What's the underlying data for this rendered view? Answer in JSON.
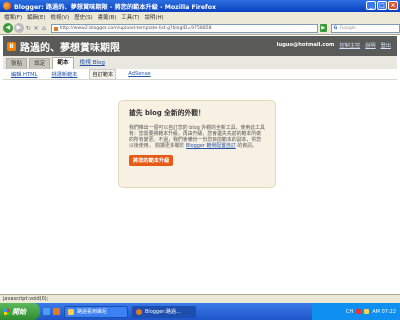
{
  "window": {
    "title": "Blogger: 路過的、夢想賞味期限 - 將您的範本升級 - Mozilla Firefox",
    "minimize": "_",
    "maximize": "□",
    "close": "×"
  },
  "menu": [
    "檔案(F)",
    "編輯(E)",
    "檢視(V)",
    "歷史(S)",
    "書籤(B)",
    "工具(T)",
    "說明(H)"
  ],
  "nav": {
    "url": "http://www2.blogger.com/upload-template-list.g?blogID=9758858",
    "search_placeholder": "Google",
    "go": "▶"
  },
  "blog": {
    "logo": "B",
    "title": "路過的、夢想賞味期限",
    "email": "luguo@hotmail.com",
    "dashboard": "控制主控",
    "help": "說明",
    "signout": "登出"
  },
  "tabs": [
    "張貼",
    "設定",
    "範本",
    "檢視 Blog"
  ],
  "subtabs": [
    "編輯 HTML",
    "挑選新範本",
    "自訂範本",
    "AdSense"
  ],
  "card": {
    "heading": "搶先 blog 全新的外觀！",
    "body": "我們推出一個可以自訂您的 blog 外觀的全新工具，使用此工具有：您需要將範本升級，再由升級，您會遺失先前的範本所做的所有變更。不過，我們會備份一份您目前範本的副本，供您以後使用。",
    "more_prefix": "閱讀更多關於",
    "more_link": "Blogger 範例配置自訂",
    "more_suffix": "的資訊。",
    "button": "將您的範本升級"
  },
  "status": "javascript:void(0);",
  "taskbar": {
    "start": "開始",
    "tasks": [
      "路過看到維尼",
      "Blogger:路過..."
    ],
    "lang": "CH",
    "time": "AM 07:22"
  },
  "colors": {
    "accent": "#e65a16",
    "header": "#5a5a58",
    "link": "#2255aa"
  }
}
